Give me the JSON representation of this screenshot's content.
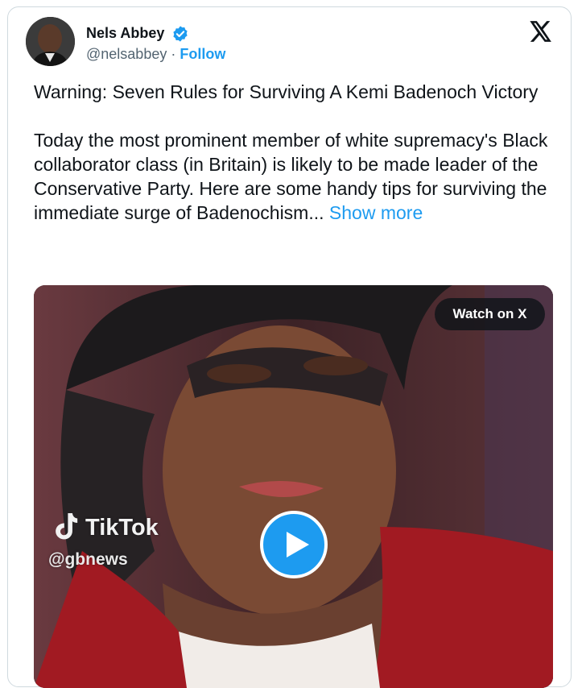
{
  "author": {
    "name": "Nels Abbey",
    "handle": "@nelsabbey",
    "separator": " · ",
    "follow_label": "Follow",
    "verified": true
  },
  "tweet": {
    "text": "Warning: Seven Rules for Surviving A Kemi Badenoch Victory\n\nToday the most prominent member of white supremacy's Black collaborator class (in Britain) is likely to be made leader of the Conservative Party. Here are some handy tips for surviving the immediate surge of Badenochism... ",
    "show_more_label": "Show more"
  },
  "media": {
    "watch_label": "Watch on X",
    "watermark_brand": "TikTok",
    "watermark_handle": "@gbnews"
  },
  "colors": {
    "accent": "#1d9bf0",
    "text_primary": "#0f1419",
    "text_secondary": "#536471"
  },
  "icons": {
    "platform": "x-logo-icon",
    "verified": "verified-badge-icon",
    "play": "play-icon"
  }
}
